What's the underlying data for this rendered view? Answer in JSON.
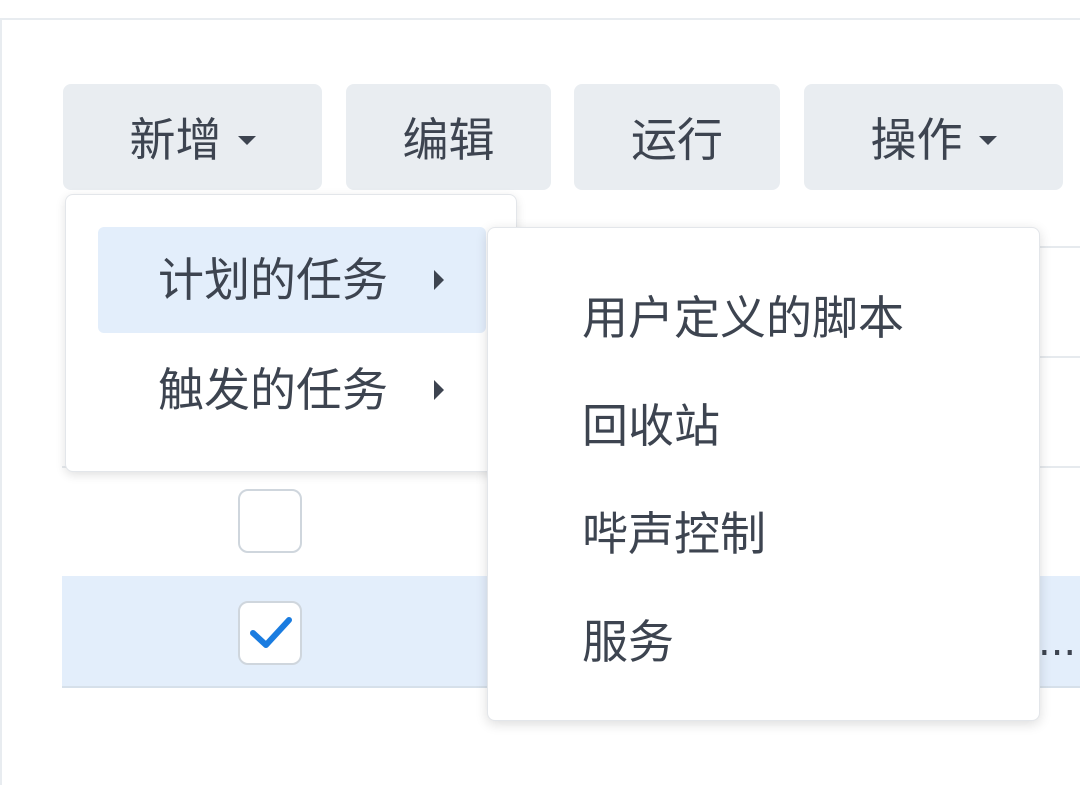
{
  "toolbar": {
    "add_label": "新增",
    "edit_label": "编辑",
    "run_label": "运行",
    "action_label": "操作"
  },
  "add_menu": {
    "items": [
      {
        "label": "计划的任务",
        "has_submenu": true,
        "active": true
      },
      {
        "label": "触发的任务",
        "has_submenu": true,
        "active": false
      }
    ]
  },
  "submenu": {
    "items": [
      {
        "label": "用户定义的脚本"
      },
      {
        "label": "回收站"
      },
      {
        "label": "哔声控制"
      },
      {
        "label": "服务"
      }
    ]
  },
  "table": {
    "rows": [
      {
        "checked": false
      },
      {
        "checked": true,
        "selected": true,
        "truncated_text": "..."
      }
    ]
  },
  "colors": {
    "button_bg": "#e9edf1",
    "selection_bg": "#e3eefb",
    "check_accent": "#1a7ce0",
    "text": "#3d4450"
  }
}
